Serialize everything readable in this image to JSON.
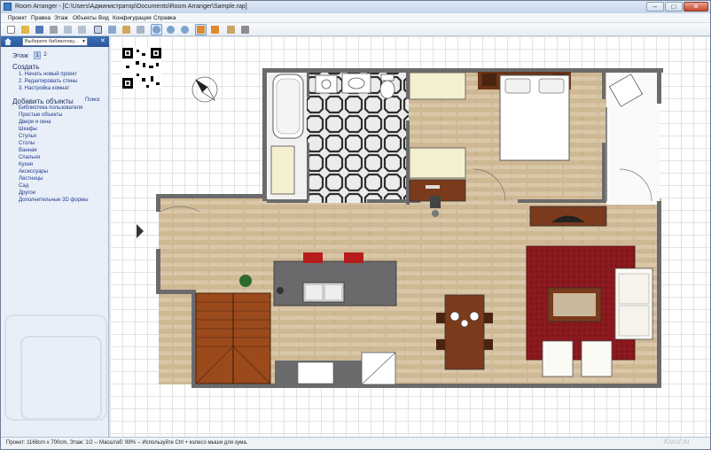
{
  "window": {
    "title": "Room Arranger - [C:\\Users\\Администратор\\Documents\\Room Arranger\\Sample.rap]",
    "min_glyph": "–",
    "max_glyph": "□",
    "close_glyph": "✕"
  },
  "menu": {
    "items": [
      "Проект",
      "Правка",
      "Этаж",
      "Объекты",
      "Вид",
      "Конфигурация",
      "Справка"
    ]
  },
  "toolbar": {
    "buttons": [
      "new-project",
      "open",
      "save",
      "print",
      "undo",
      "redo",
      "select",
      "rotate",
      "measure",
      "zoom-fit",
      "zoom-in",
      "zoom-out",
      "view-2d",
      "view-3d",
      "render-3d",
      "walk-3d"
    ]
  },
  "sidebar": {
    "library_select": "Выберите библиотеку...",
    "floor_label": "Этаж",
    "floor_tabs": [
      "1",
      "2"
    ],
    "create_title": "Создать",
    "create_items": [
      "1. Начать новый проект",
      "2. Редактировать стены",
      "3. Настройка комнат"
    ],
    "add_title": "Добавить объекты",
    "search_label": "Поиск",
    "object_items": [
      "Библиотека пользователя",
      "Простые объекты",
      "Двери и окна",
      "Шкафы",
      "Стулья",
      "Столы",
      "Ванная",
      "Спальня",
      "Кухня",
      "Аксессуары",
      "Лестницы",
      "Сад",
      "Другое",
      "Дополнительные 3D формы"
    ]
  },
  "status": {
    "text": "Проект: 1168cm x 700cm, Этаж: 1/2 -- Масштаб: 99% -- Используйте Ctrl + колесо мыши для зума."
  },
  "watermark": "Koruf.ru",
  "colors": {
    "wall": "#6b6b6b",
    "floor_wood": "#d8c7ab",
    "rug": "#8c1a1f",
    "kitchen_counter": "#6a6a6d",
    "furniture_wood": "#7a3a1b",
    "cabinet": "#f4efcf"
  }
}
